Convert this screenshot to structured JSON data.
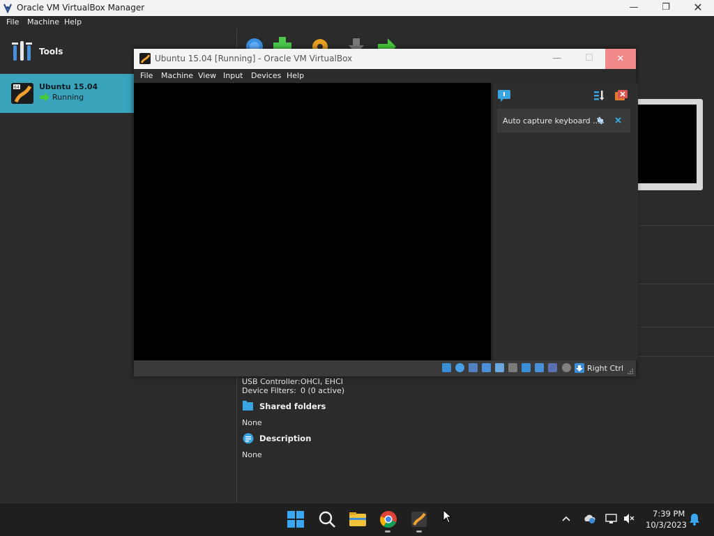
{
  "manager": {
    "title": "Oracle VM VirtualBox Manager",
    "menu": [
      "File",
      "Machine",
      "Help"
    ],
    "tools_label": "Tools",
    "vm_list": [
      {
        "name": "Ubuntu 15.04",
        "status": "Running"
      }
    ],
    "details": {
      "usb_controller_label": "USB Controller:",
      "usb_controller_value": "OHCI, EHCI",
      "device_filters_label": "Device Filters:",
      "device_filters_value": "0 (0 active)",
      "shared_folders_title": "Shared folders",
      "shared_folders_value": "None",
      "description_title": "Description",
      "description_value": "None"
    }
  },
  "vm_window": {
    "title": "Ubuntu 15.04 [Running] - Oracle VM VirtualBox",
    "menu": [
      "File",
      "Machine",
      "View",
      "Input",
      "Devices",
      "Help"
    ],
    "notification": "Auto capture keyboard ...",
    "host_key": "Right Ctrl"
  },
  "taskbar": {
    "time": "7:39 PM",
    "date": "10/3/2023"
  },
  "colors": {
    "accent": "#3aa4bd",
    "background": "#2b2b2b",
    "vm_close": "#f08a8a"
  }
}
